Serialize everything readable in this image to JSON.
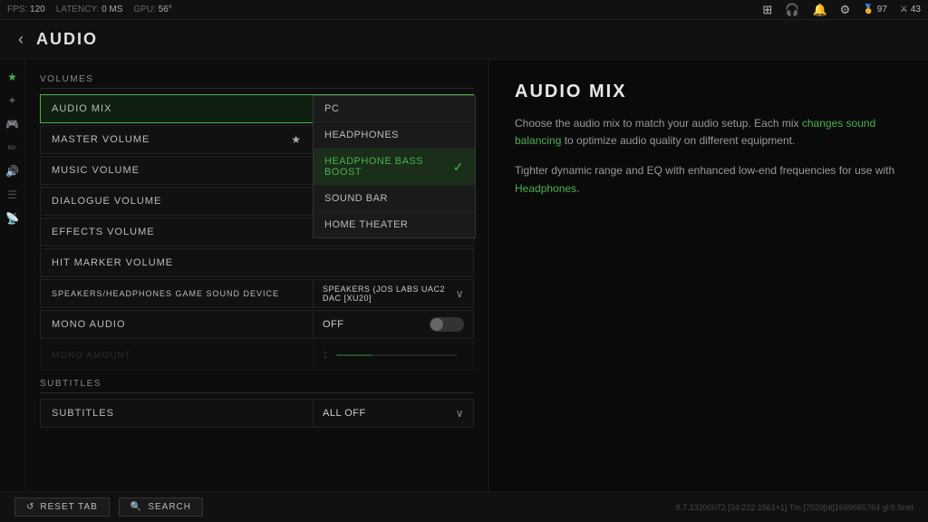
{
  "topbar": {
    "fps_label": "FPS:",
    "fps_value": "120",
    "latency_label": "LATENCY:",
    "latency_value": "0 MS",
    "gpu_label": "GPU:",
    "gpu_value": "56°",
    "icons": [
      "grid",
      "headphones",
      "bell",
      "gear",
      "medal"
    ],
    "score1": "97",
    "score2": "43"
  },
  "header": {
    "back": "‹",
    "title": "AUDIO"
  },
  "sidebar_icons": [
    "★",
    "✦",
    "🎮",
    "✏",
    "🔊",
    "☰",
    "📡"
  ],
  "sections": {
    "volumes_label": "VOLUMES",
    "subtitles_label": "SUBTITLES"
  },
  "settings": {
    "audio_mix": {
      "label": "AUDIO MIX",
      "value": "HEADPHONE BASS BOOST",
      "open": true
    },
    "master_volume": {
      "label": "MASTER VOLUME",
      "value": "",
      "has_star": true
    },
    "music_volume": {
      "label": "MUSIC VOLUME"
    },
    "dialogue_volume": {
      "label": "DIALOGUE VOLUME"
    },
    "effects_volume": {
      "label": "EFFECTS VOLUME"
    },
    "hit_marker_volume": {
      "label": "HIT MARKER VOLUME"
    },
    "sound_device": {
      "label": "SPEAKERS/HEADPHONES GAME SOUND DEVICE",
      "value": "SPEAKERS (JOS LABS UAC2 DAC [XU20]"
    },
    "mono_audio": {
      "label": "MONO AUDIO",
      "value": "OFF"
    },
    "mono_amount": {
      "label": "MONO AMOUNT",
      "value": "1",
      "disabled": true
    }
  },
  "dropdown_options": [
    {
      "label": "PC",
      "selected": false
    },
    {
      "label": "HEADPHONES",
      "selected": false
    },
    {
      "label": "HEADPHONE BASS BOOST",
      "selected": true
    },
    {
      "label": "SOUND BAR",
      "selected": false
    },
    {
      "label": "HOME THEATER",
      "selected": false
    }
  ],
  "subtitles": {
    "label": "SUBTITLES",
    "value": "ALL OFF"
  },
  "info": {
    "title": "AUDIO MIX",
    "paragraph1_before": "Choose the audio mix to match your audio setup. Each mix ",
    "paragraph1_link": "changes sound balancing",
    "paragraph1_after": " to optimize audio quality on different equipment.",
    "paragraph2_before": "Tighter dynamic range and EQ with enhanced low-end frequencies for use with ",
    "paragraph2_link": "Headphones",
    "paragraph2_after": "."
  },
  "bottom": {
    "reset_label": "RESET TAB",
    "search_label": "SEARCH",
    "version": "8.7.13200072 [34:222:1561+1] Tm [7020[dl]1669665764 gl:6.5net"
  }
}
